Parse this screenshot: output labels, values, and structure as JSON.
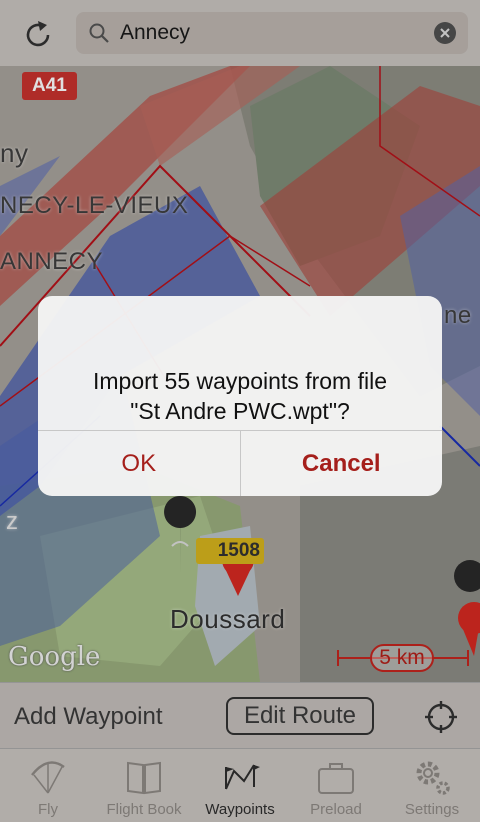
{
  "header": {
    "search_value": "Annecy",
    "refresh_icon": "refresh-icon",
    "search_icon": "search-icon",
    "clear_icon": "clear-icon"
  },
  "map": {
    "road_badge": "A41",
    "road_badge_2": "1508",
    "labels": {
      "partial_town": "ny",
      "annecy_le_vieux": "NECY-LE-VIEUX",
      "annecy": "ANNECY",
      "right_partial": "ne",
      "left_partial": "z",
      "doussard": "Doussard"
    },
    "attribution": "Google",
    "scale": "5 km",
    "colors": {
      "airspace_red": "#b5473f",
      "airspace_blue": "#4f63b6",
      "accent": "#a51f1b"
    }
  },
  "dialog": {
    "line1": "Import 55 waypoints from file",
    "line2": "\"St Andre PWC.wpt\"?",
    "ok": "OK",
    "cancel": "Cancel"
  },
  "actionbar": {
    "add_waypoint": "Add Waypoint",
    "edit_route": "Edit Route",
    "locate_icon": "locate-icon"
  },
  "tabs": [
    {
      "label": "Fly",
      "icon": "paraglider-icon",
      "active": false
    },
    {
      "label": "Flight Book",
      "icon": "book-icon",
      "active": false
    },
    {
      "label": "Waypoints",
      "icon": "waypoints-icon",
      "active": true
    },
    {
      "label": "Preload",
      "icon": "suitcase-icon",
      "active": false
    },
    {
      "label": "Settings",
      "icon": "gear-icon",
      "active": false
    }
  ]
}
